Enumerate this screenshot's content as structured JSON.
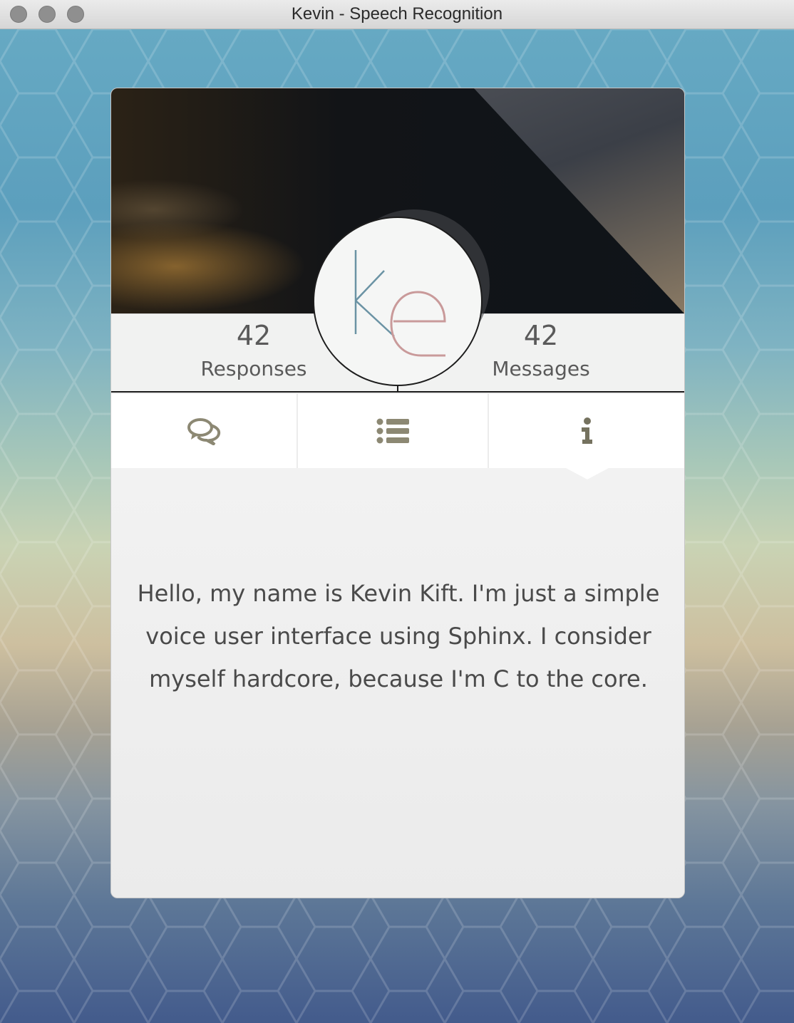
{
  "window": {
    "title": "Kevin - Speech Recognition"
  },
  "profile": {
    "stats": {
      "responses": {
        "value": "42",
        "label": "Responses"
      },
      "messages": {
        "value": "42",
        "label": "Messages"
      }
    },
    "avatar": {
      "initials": "ke",
      "letter_colors": [
        "#6b93a4",
        "#c99a9a"
      ]
    }
  },
  "tabs": [
    {
      "icon": "chat-bubbles-icon",
      "selected": false
    },
    {
      "icon": "list-icon",
      "selected": false
    },
    {
      "icon": "info-icon",
      "selected": true
    }
  ],
  "about": {
    "text": "Hello, my name is Kevin Kift. I'm just a simple voice user interface using Sphinx. I consider myself hardcore, because I'm C to the core."
  },
  "colors": {
    "icon": "#8c8873",
    "text": "#4a4a4a"
  }
}
